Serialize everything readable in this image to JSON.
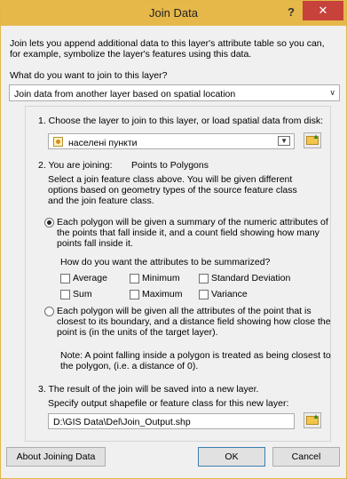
{
  "window": {
    "title": "Join Data",
    "help": "?",
    "close": "✕"
  },
  "intro": {
    "line1": "Join lets you append additional data to this layer's attribute table so you can,",
    "line2": "for example, symbolize the layer's features using this data."
  },
  "join_type": {
    "question": "What do you want to join to this layer?",
    "selected": "Join data from another layer based on spatial location"
  },
  "step1": {
    "label": "1.  Choose the layer to join to this layer, or load spatial data from disk:",
    "layer": "населені пункти"
  },
  "step2": {
    "label": "2.  You are joining:",
    "joining": "Points to Polygons",
    "desc1": "Select a join feature class above.  You will be given different",
    "desc2": "options based on geometry types of the source feature class",
    "desc3": "and the join feature class.",
    "opt1_line1": "Each polygon will be given a summary of the numeric attributes of",
    "opt1_line2": "the points that fall inside it, and a count field showing how many",
    "opt1_line3": "points fall inside it.",
    "summarize_q": "How do you want the attributes to be summarized?",
    "cb_average": "Average",
    "cb_minimum": "Minimum",
    "cb_stddev": "Standard Deviation",
    "cb_sum": "Sum",
    "cb_maximum": "Maximum",
    "cb_variance": "Variance",
    "opt2_line1": "Each polygon will be given all the attributes of the point that is",
    "opt2_line2": "closest to its boundary, and a distance field showing how close the",
    "opt2_line3": "point is (in the units of the target layer).",
    "note1": "Note: A point falling inside a polygon is treated as being closest to",
    "note2": "the polygon, (i.e. a distance of 0)."
  },
  "step3": {
    "label": "3.  The result of the join will be saved into a new layer.",
    "specify": "Specify output shapefile or feature class for this new layer:",
    "path": "D:\\GIS Data\\Del\\Join_Output.shp"
  },
  "buttons": {
    "about": "About Joining Data",
    "ok": "OK",
    "cancel": "Cancel"
  },
  "colors": {
    "titlebar": "#e6b84a",
    "close": "#c7423a"
  }
}
